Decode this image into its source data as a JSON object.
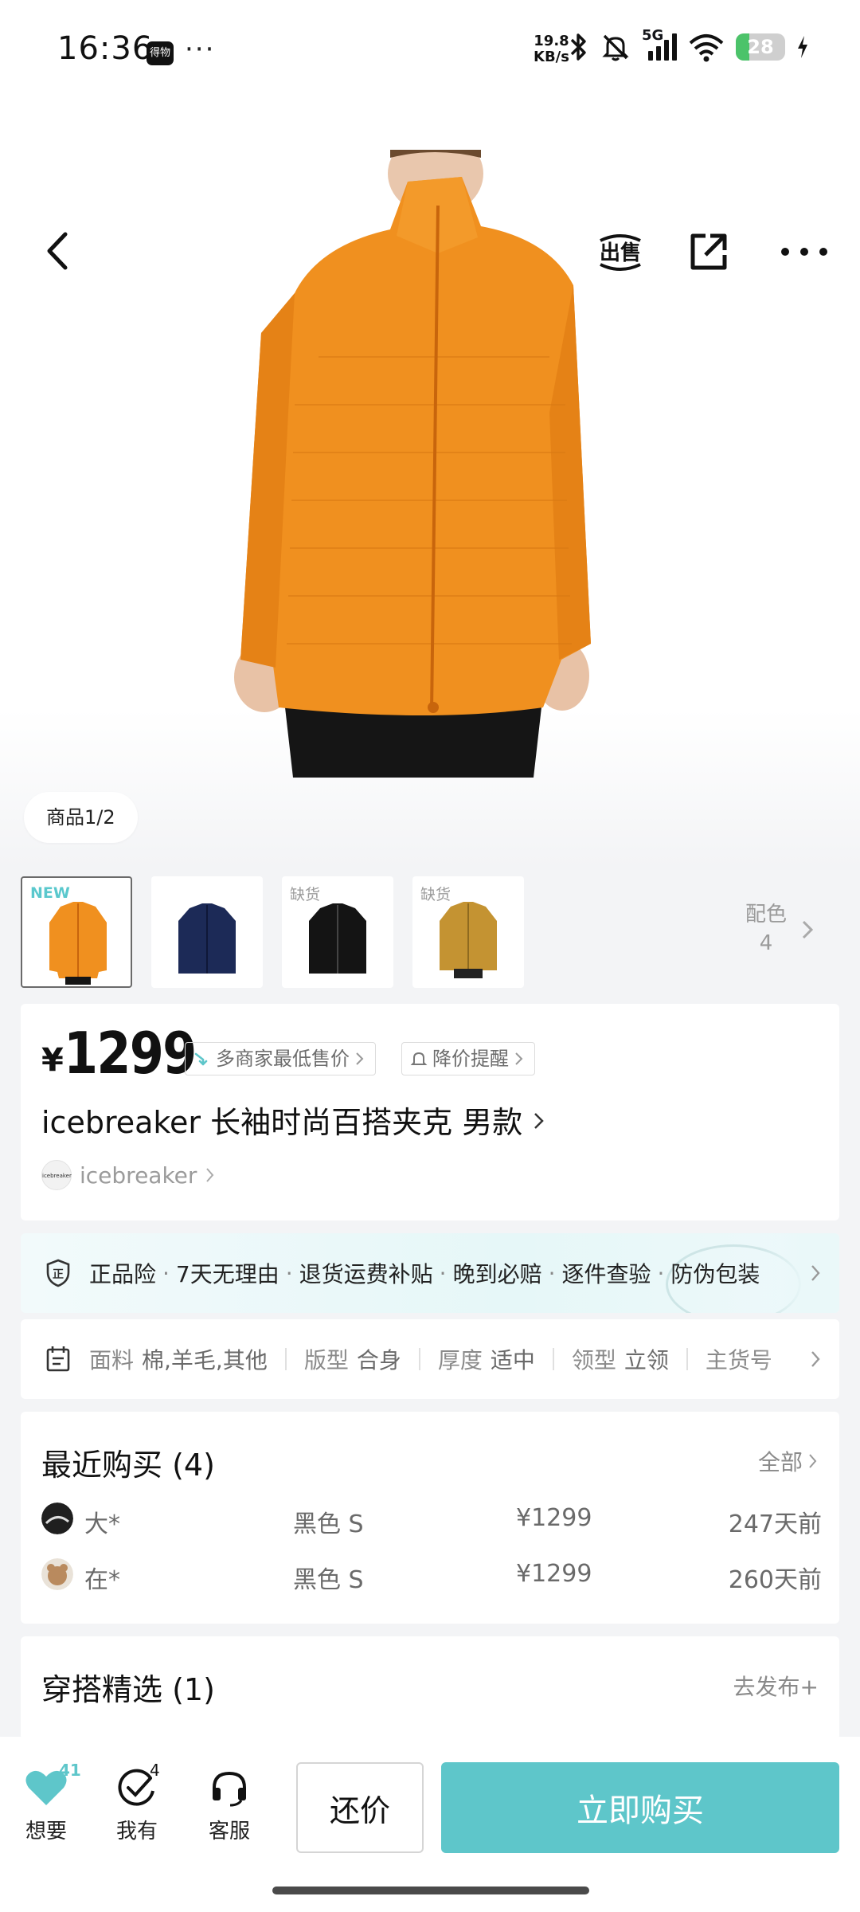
{
  "status_bar": {
    "time": "16:36",
    "app_icon_label": "得物",
    "more_dots": "···",
    "net_speed_value": "19.8",
    "net_speed_unit": "KB/s",
    "network": "5G",
    "battery": "28",
    "battery_level": 0.28
  },
  "nav": {
    "sell_icon": "出售",
    "back_icon": "chevron-left",
    "share_icon": "share-external",
    "more_icon": "more-horizontal"
  },
  "hero": {
    "page_indicator": "商品1/2",
    "main_color": "#f0901f"
  },
  "colors": {
    "items": [
      {
        "tag": "NEW",
        "color": "#f0901f",
        "selected": true
      },
      {
        "tag": "",
        "color": "#1c2a57",
        "selected": false
      },
      {
        "tag": "缺货",
        "color": "#141414",
        "selected": false
      },
      {
        "tag": "缺货",
        "color": "#c49332",
        "selected": false
      }
    ],
    "count_label": "配色",
    "count_value": "4"
  },
  "product": {
    "currency": "¥",
    "price": "1299",
    "lowest_price_tag": "多商家最低售价",
    "price_alert_tag": "降价提醒",
    "title": "icebreaker 长袖时尚百搭夹克 男款",
    "brand": "icebreaker",
    "brand_logo_text": "icebreaker"
  },
  "guarantee": {
    "items": [
      "正品险",
      "7天无理由",
      "退货运费补贴",
      "晚到必赔",
      "逐件查验",
      "防伪包装"
    ]
  },
  "attributes": {
    "items": [
      {
        "key": "面料",
        "value": "棉,羊毛,其他"
      },
      {
        "key": "版型",
        "value": "合身"
      },
      {
        "key": "厚度",
        "value": "适中"
      },
      {
        "key": "领型",
        "value": "立领"
      },
      {
        "key": "主货号",
        "value": ""
      }
    ]
  },
  "recent_purchases": {
    "title": "最近购买 (4)",
    "all_link": "全部",
    "rows": [
      {
        "name": "大*",
        "spec": "黑色 S",
        "price": "¥1299",
        "time": "247天前"
      },
      {
        "name": "在*",
        "spec": "黑色 S",
        "price": "¥1299",
        "time": "260天前"
      }
    ]
  },
  "outfit": {
    "title": "穿搭精选 (1)",
    "publish_link": "去发布+"
  },
  "bottom_bar": {
    "want_label": "想要",
    "want_count": "41",
    "have_label": "我有",
    "have_count": "4",
    "service_label": "客服",
    "bargain_button": "还价",
    "buy_button": "立即购买",
    "accent_color": "#5ec6ca"
  }
}
